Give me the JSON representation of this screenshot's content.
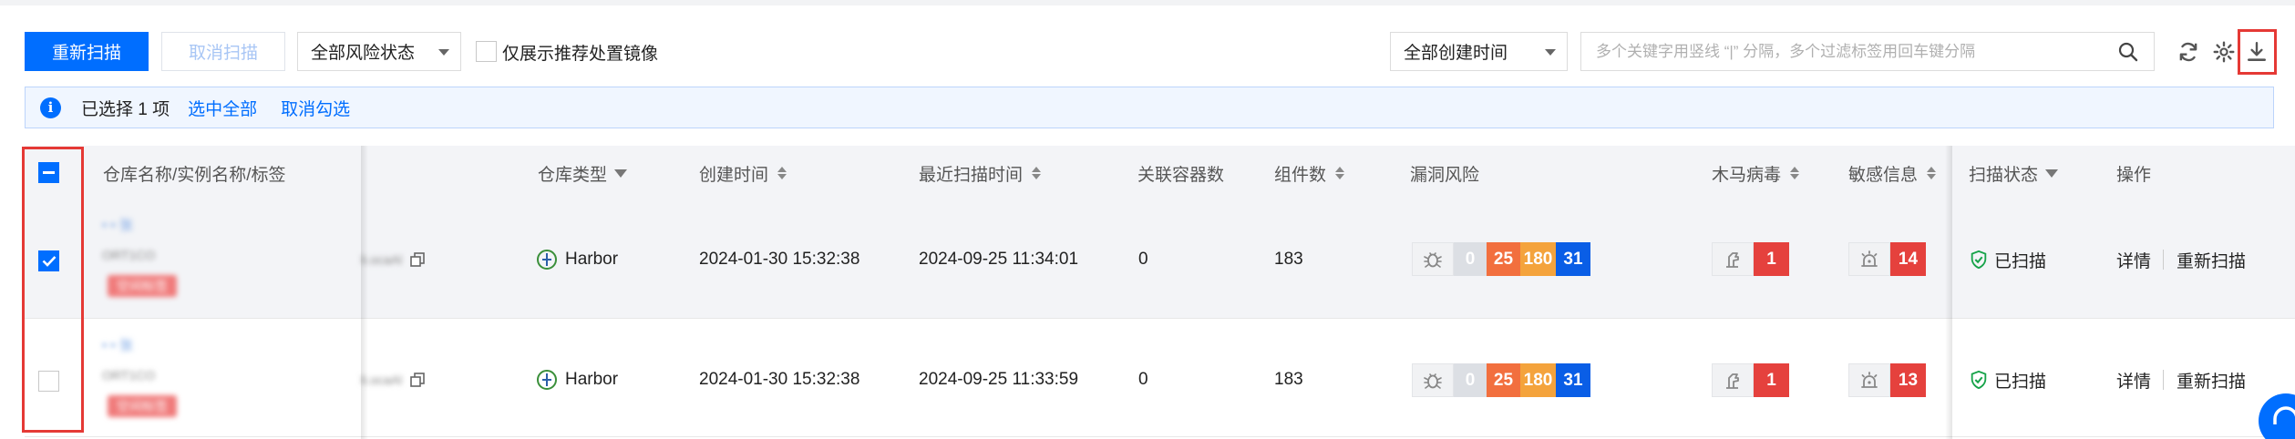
{
  "toolbar": {
    "rescan_label": "重新扫描",
    "cancel_scan_label": "取消扫描",
    "risk_filter_value": "全部风险状态",
    "only_recommended_label": "仅展示推荐处置镜像",
    "time_filter_value": "全部创建时间",
    "search_placeholder": "多个关键字用竖线 “|” 分隔，多个过滤标签用回车键分隔"
  },
  "selection": {
    "info_icon_glyph": "i",
    "selected_text": "已选择 1 项",
    "select_all_link": "选中全部",
    "deselect_link": "取消勾选"
  },
  "columns": {
    "name": "仓库名称/实例名称/标签",
    "repo_type": "仓库类型",
    "created_time": "创建时间",
    "last_scan_time": "最近扫描时间",
    "containers": "关联容器数",
    "components": "组件数",
    "vuln_risk": "漏洞风险",
    "trojan": "木马病毒",
    "sensitive": "敏感信息",
    "scan_status": "扫描状态",
    "actions": "操作"
  },
  "rows": [
    {
      "checked": true,
      "name_line1": "• • 张",
      "name_line2": "ORT1CO",
      "name_tag": "空间标签",
      "name_suffix": "li.ocaAl",
      "repo_type": "Harbor",
      "created_time": "2024-01-30 15:32:38",
      "last_scan_time": "2024-09-25 11:34:01",
      "containers": "0",
      "components": "183",
      "vuln": {
        "none": "0",
        "medium": "25",
        "high": "180",
        "critical": "31"
      },
      "trojan": "1",
      "sensitive": "14",
      "scan_status": "已扫描",
      "action_detail": "详情",
      "action_rescan": "重新扫描"
    },
    {
      "checked": false,
      "name_line1": "• • 张",
      "name_line2": "ORT1CO",
      "name_tag": "空间标签",
      "name_suffix": "li.ocaAl",
      "repo_type": "Harbor",
      "created_time": "2024-01-30 15:32:38",
      "last_scan_time": "2024-09-25 11:33:59",
      "containers": "0",
      "components": "183",
      "vuln": {
        "none": "0",
        "medium": "25",
        "high": "180",
        "critical": "31"
      },
      "trojan": "1",
      "sensitive": "13",
      "scan_status": "已扫描",
      "action_detail": "详情",
      "action_rescan": "重新扫描"
    }
  ],
  "colors": {
    "accent": "#006eff",
    "vuln_none": "#dcdfe4",
    "vuln_medium": "#f26f3e",
    "vuln_high": "#f4a33c",
    "vuln_critical": "#0a5ee6",
    "danger": "#e5413d",
    "success": "#17a34a"
  },
  "icons": [
    "refresh-icon",
    "settings-icon",
    "download-icon",
    "search-icon",
    "bug-icon",
    "trojan-icon",
    "alarm-icon",
    "shield-check-icon",
    "harbor-icon",
    "copy-icon",
    "info-icon"
  ]
}
